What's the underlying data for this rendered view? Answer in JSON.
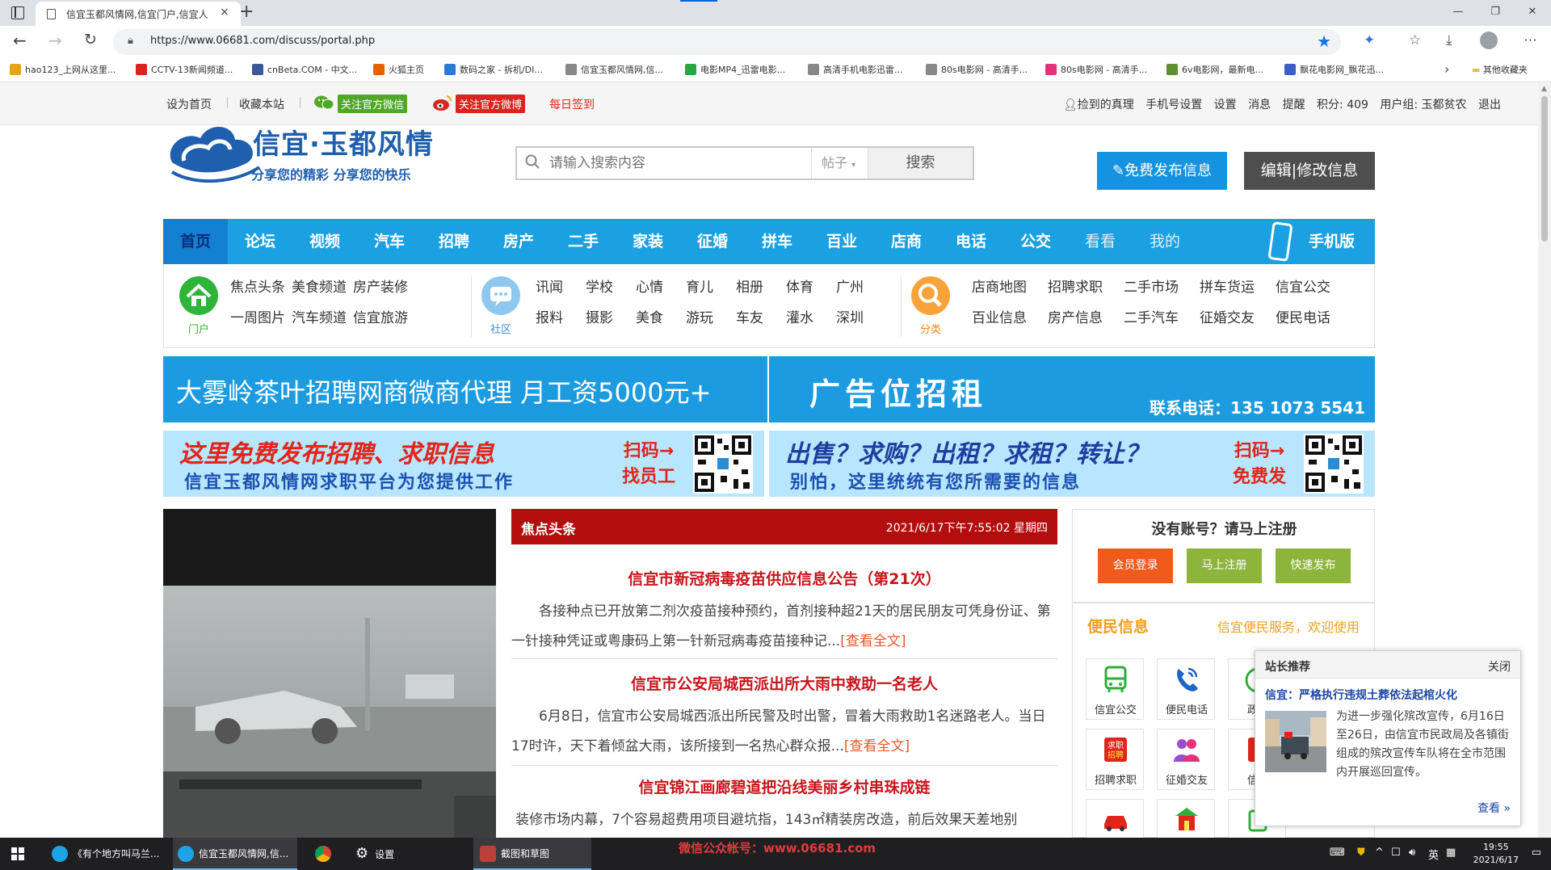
{
  "browser": {
    "tab_title": "信宜玉都风情网,信宜门户,信宜人",
    "tab_close": "×",
    "new_tab": "+",
    "window_buttons": [
      "—",
      "❐",
      "✕"
    ],
    "url": "https://www.06681.com/discuss/portal.php",
    "bookmarks": [
      {
        "label": "hao123_上网从这里...",
        "color": "#e8a317"
      },
      {
        "label": "CCTV-13新闻频道...",
        "color": "#d9251d"
      },
      {
        "label": "cnBeta.COM - 中文...",
        "color": "#3b5998"
      },
      {
        "label": "火狐主页",
        "color": "#e66000"
      },
      {
        "label": "数码之家 - 拆机/DI...",
        "color": "#2b7bd6"
      },
      {
        "label": "信宜玉都风情网,信...",
        "color": "#888888"
      },
      {
        "label": "电影MP4_迅雷电影...",
        "color": "#28a745"
      },
      {
        "label": "高清手机电影迅雷...",
        "color": "#888888"
      },
      {
        "label": "80s电影网 - 高清手...",
        "color": "#888888"
      },
      {
        "label": "80s电影网 - 高清手...",
        "color": "#e5337a"
      },
      {
        "label": "6v电影网，最新电...",
        "color": "#5c8f2e"
      },
      {
        "label": "飘花电影网_飘花迅...",
        "color": "#3d5fc4"
      }
    ],
    "bookmarks_other": "其他收藏夹"
  },
  "topbar": {
    "set_home": "设为首页",
    "favorite": "收藏本站",
    "follow_wechat": "关注官方微信",
    "follow_weibo": "关注官方微博",
    "daily_sign": "每日签到",
    "user": "捡到的真理",
    "links": [
      "手机号设置",
      "设置",
      "消息",
      "提醒",
      "积分: 409",
      "用户组: 玉都贫农",
      "退出"
    ]
  },
  "header": {
    "logo_title": "信宜·玉都风情",
    "logo_slogan": "分享您的精彩  分享您的快乐",
    "search_placeholder": "请输入搜索内容",
    "search_type": "帖子",
    "search_button": "搜索",
    "publish_button": "免费发布信息",
    "edit_button": "编辑|修改信息"
  },
  "nav": {
    "items": [
      "首页",
      "论坛",
      "视频",
      "汽车",
      "招聘",
      "房产",
      "二手",
      "家装",
      "征婚",
      "拼车",
      "百业",
      "店商",
      "电话",
      "公交",
      "看看",
      "我的"
    ],
    "mobile": "手机版"
  },
  "subnav": {
    "portal": {
      "caption": "门户",
      "links": [
        "焦点头条",
        "美食频道",
        "房产装修",
        "一周图片",
        "汽车频道",
        "信宜旅游"
      ]
    },
    "community": {
      "caption": "社区",
      "links": [
        "讯闻",
        "学校",
        "心情",
        "育儿",
        "相册",
        "体育",
        "广州",
        "报料",
        "摄影",
        "美食",
        "游玩",
        "车友",
        "灌水",
        "深圳"
      ]
    },
    "category": {
      "caption": "分类",
      "links": [
        "店商地图",
        "招聘求职",
        "二手市场",
        "拼车货运",
        "信宜公交",
        "百业信息",
        "房产信息",
        "二手汽车",
        "征婚交友",
        "便民电话"
      ]
    }
  },
  "ads": {
    "ad1": "大雾岭茶叶招聘网商微商代理   月工资5000元+",
    "ad2_title": "广告位招租",
    "ad2_phone": "联系电话：135 1073 5541",
    "ad3_line1": "这里免费发布招聘、求职信息",
    "ad3_line2": "信宜玉都风情网求职平台为您提供工作",
    "ad3_scan": [
      "扫码→",
      "找员工"
    ],
    "ad4_line1": "出售？求购？出租？求租？转让？",
    "ad4_line2": "别怕，这里统统有您所需要的信息",
    "ad4_scan": [
      "扫码→",
      "免费发"
    ]
  },
  "news": {
    "header": "焦点头条",
    "datetime": "2021/6/17下午7:55:02 星期四",
    "items": [
      {
        "title": "信宜市新冠病毒疫苗供应信息公告（第21次）",
        "body": "各接种点已开放第二剂次疫苗接种预约，首剂接种超21天的居民朋友可凭身份证、第一针接种凭证或粤康码上第一针新冠病毒疫苗接种记...",
        "more": "[查看全文]"
      },
      {
        "title": "信宜市公安局城西派出所大雨中救助一名老人",
        "body": "6月8日，信宜市公安局城西派出所民警及时出警，冒着大雨救助1名迷路老人。当日17时许，天下着倾盆大雨，该所接到一名热心群众报...",
        "more": "[查看全文]"
      },
      {
        "title": "信宜锦江画廊碧道把沿线美丽乡村串珠成链",
        "body": "装修市场内幕，7个容易超费用项目避坑指，143㎡精装房改造，前后效果天差地别",
        "more": ""
      }
    ]
  },
  "register": {
    "title": "没有账号？请马上注册",
    "buttons": [
      {
        "label": "会员登录",
        "color": "#f05a1a"
      },
      {
        "label": "马上注册",
        "color": "#8db53c"
      },
      {
        "label": "快速发布",
        "color": "#8db53c"
      }
    ]
  },
  "service": {
    "title": "便民信息",
    "subtitle": "信宜便民服务，欢迎使用",
    "tiles": [
      "信宜公交",
      "便民电话",
      "政府",
      "招聘求职",
      "征婚交友",
      "信宜",
      "",
      "",
      ""
    ]
  },
  "popup": {
    "title": "站长推荐",
    "close": "关闭",
    "news_title": "信宜：严格执行违规土葬依法起棺火化",
    "text": "为进一步强化殡改宣传，6月16日至26日，由信宜市民政局及各镇街组成的殡改宣传车队将在全市范围内开展巡回宣传。",
    "more": "查看 »"
  },
  "taskbar": {
    "items": [
      "《有个地方叫马兰...",
      "信宜玉都风情网,信...",
      "",
      "设置",
      "截图和草图"
    ],
    "watermark": "微信公众帐号：www.06681.com",
    "ime": "英",
    "time": "19:55",
    "date": "2021/6/17"
  }
}
